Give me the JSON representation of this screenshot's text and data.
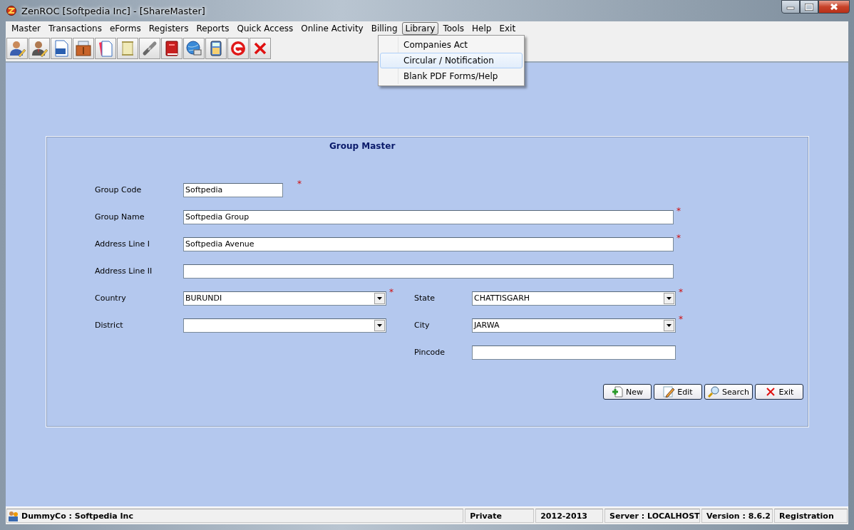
{
  "window": {
    "title": "ZenROC [Softpedia Inc] - [ShareMaster]"
  },
  "menu": [
    {
      "label": "Master",
      "selected": false
    },
    {
      "label": "Transactions",
      "selected": false
    },
    {
      "label": "eForms",
      "selected": false
    },
    {
      "label": "Registers",
      "selected": false
    },
    {
      "label": "Reports",
      "selected": false
    },
    {
      "label": "Quick Access",
      "selected": false
    },
    {
      "label": "Online Activity",
      "selected": false
    },
    {
      "label": "Billing",
      "selected": false
    },
    {
      "label": "Library",
      "selected": true
    },
    {
      "label": "Tools",
      "selected": false
    },
    {
      "label": "Help",
      "selected": false
    },
    {
      "label": "Exit",
      "selected": false
    }
  ],
  "dropdown": [
    {
      "label": "Companies Act",
      "selected": false
    },
    {
      "label": "Circular / Notification",
      "selected": true
    },
    {
      "label": "Blank PDF Forms/Help",
      "selected": false
    }
  ],
  "form": {
    "title": "Group Master",
    "rows": [
      {
        "left": {
          "label": "Group Code",
          "value": "Softpedia",
          "kind": "short",
          "required_mark": "*"
        }
      },
      {
        "left": {
          "label": "Group Name",
          "value": "Softpedia Group",
          "kind": "wide",
          "required_mark": "*"
        }
      },
      {
        "left": {
          "label": "Address Line I",
          "value": "Softpedia Avenue",
          "kind": "wide",
          "required_mark": "*"
        }
      },
      {
        "left": {
          "label": "Address Line II",
          "kind": "wide"
        }
      },
      {
        "left": {
          "label": "Country",
          "value": "BURUNDI",
          "kind": "dropdown",
          "required_mark": "*"
        },
        "right": {
          "label": "State",
          "value": "CHATTISGARH",
          "kind": "dropdown",
          "required_mark": "*"
        }
      },
      {
        "left": {
          "label": "District",
          "kind": "dropdown"
        },
        "right": {
          "label": "City",
          "value": "JARWA",
          "kind": "dropdown",
          "required_mark": "*"
        }
      },
      {
        "right": {
          "label": "Pincode",
          "kind": "text"
        }
      }
    ],
    "buttons": [
      {
        "label": "New",
        "kind": "new"
      },
      {
        "label": "Edit",
        "kind": "edit"
      },
      {
        "label": "Search",
        "kind": "search"
      },
      {
        "label": "Exit",
        "kind": "exit"
      }
    ]
  },
  "status_bar": {
    "company": "DummyCo : Softpedia Inc",
    "panes": [
      "Private",
      "2012-2013",
      "Server : LOCALHOST",
      "Version : 8.6.2",
      "Registration"
    ]
  }
}
